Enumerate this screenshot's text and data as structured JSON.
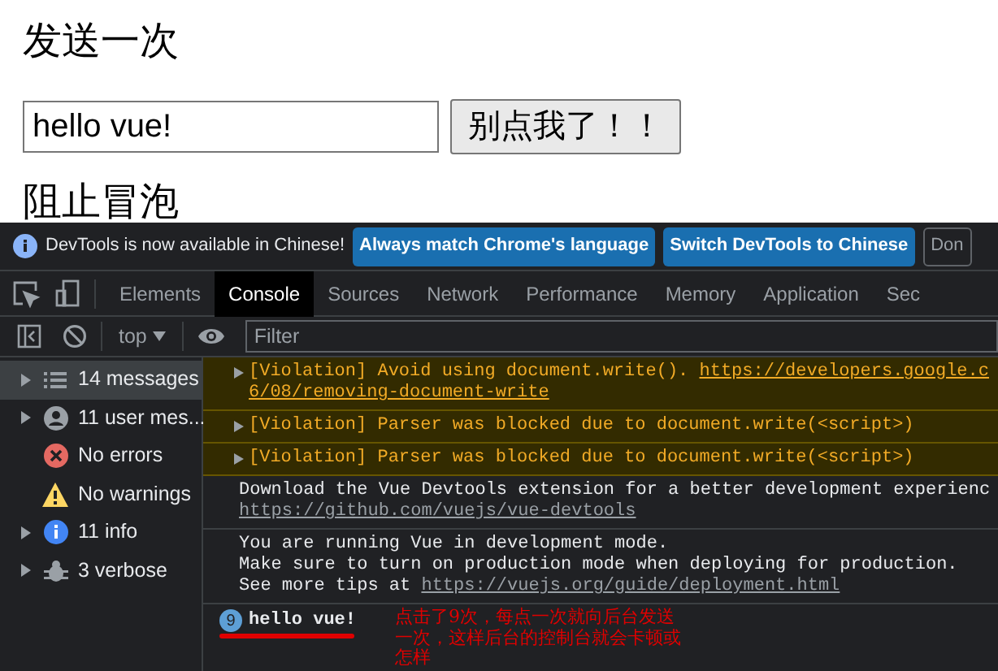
{
  "page": {
    "heading": "发送一次",
    "input": {
      "value": "hello vue!"
    },
    "button": "别点我了！！",
    "heading_2": "阻止冒泡"
  },
  "devtools": {
    "infobar": {
      "text": "DevTools is now available in Chinese!",
      "buttons": [
        "Always match Chrome's language",
        "Switch DevTools to Chinese",
        "Don"
      ]
    },
    "tabs": [
      {
        "label": "Elements",
        "selected": false
      },
      {
        "label": "Console",
        "selected": true
      },
      {
        "label": "Sources",
        "selected": false
      },
      {
        "label": "Network",
        "selected": false
      },
      {
        "label": "Performance",
        "selected": false
      },
      {
        "label": "Memory",
        "selected": false
      },
      {
        "label": "Application",
        "selected": false
      },
      {
        "label": "Sec",
        "selected": false
      }
    ],
    "toolbar": {
      "context": "top",
      "filter_placeholder": "Filter"
    },
    "sidebar": [
      {
        "kind": "list",
        "label": "14 messages",
        "selected": true,
        "expandable": true
      },
      {
        "kind": "user",
        "label": "11 user mes...",
        "selected": false,
        "expandable": true
      },
      {
        "kind": "error",
        "label": "No errors",
        "selected": false,
        "expandable": false
      },
      {
        "kind": "warning",
        "label": "No warnings",
        "selected": false,
        "expandable": false
      },
      {
        "kind": "info",
        "label": "11 info",
        "selected": false,
        "expandable": true
      },
      {
        "kind": "verbose",
        "label": "3 verbose",
        "selected": false,
        "expandable": true
      }
    ],
    "messages": [
      {
        "kind": "violation",
        "text": "[Violation] Avoid using document.write(). ",
        "link": "https://developers.google.c",
        "link_2": "6/08/removing-document-write"
      },
      {
        "kind": "violation",
        "text": "[Violation] Parser was blocked due to document.write(<script>)"
      },
      {
        "kind": "violation",
        "text": "[Violation] Parser was blocked due to document.write(<script>)"
      },
      {
        "kind": "log",
        "text": "Download the Vue Devtools extension for a better development experienc",
        "link_2": "https://github.com/vuejs/vue-devtools"
      },
      {
        "kind": "log",
        "lines": [
          "You are running Vue in development mode.",
          "Make sure to turn on production mode when deploying for production."
        ],
        "text": "See more tips at ",
        "link": "https://vuejs.org/guide/deployment.html"
      },
      {
        "kind": "repeat",
        "count": "9",
        "text": "hello vue!"
      }
    ]
  },
  "annotation": {
    "lines": [
      "点击了9次，每点一次就向后台发送",
      "一次，这样后台的控制台就会卡顿或",
      "怎样"
    ]
  }
}
